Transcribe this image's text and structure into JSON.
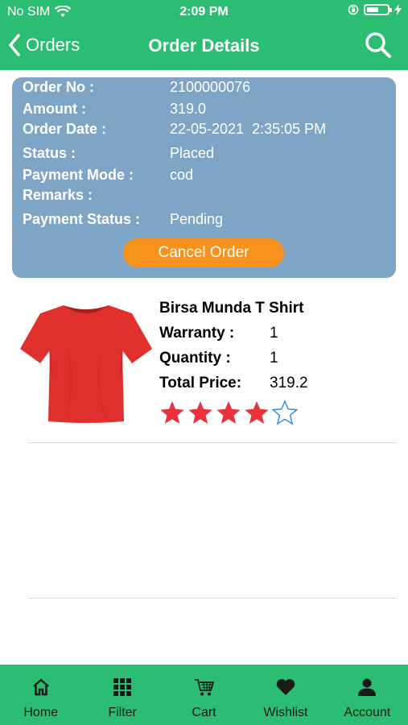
{
  "status_bar": {
    "carrier": "No SIM",
    "time": "2:09 PM"
  },
  "nav": {
    "back_label": "Orders",
    "title": "Order Details"
  },
  "order": {
    "order_no_label": "Order No :",
    "order_no": "2100000076",
    "amount_label": "Amount :",
    "amount": "319.0",
    "date_label": "Order Date :",
    "date": "22-05-2021  2:35:05 PM",
    "status_label": "Status :",
    "status": "Placed",
    "payment_mode_label": "Payment Mode :",
    "payment_mode": "cod",
    "remarks_label": "Remarks :",
    "remarks": "",
    "payment_status_label": "Payment Status :",
    "payment_status": "Pending",
    "cancel_label": "Cancel Order"
  },
  "product": {
    "name": "Birsa Munda T Shirt",
    "warranty_label": "Warranty :",
    "warranty": "1",
    "quantity_label": "Quantity :",
    "quantity": "1",
    "total_label": "Total Price:",
    "total": "319.2",
    "rating": 4,
    "rating_max": 5
  },
  "tabs": [
    {
      "label": "Home",
      "icon": "home-icon"
    },
    {
      "label": "Filter",
      "icon": "grid-icon"
    },
    {
      "label": "Cart",
      "icon": "cart-icon"
    },
    {
      "label": "Wishlist",
      "icon": "heart-icon"
    },
    {
      "label": "Account",
      "icon": "user-icon"
    }
  ],
  "colors": {
    "header": "#2bbd71",
    "card": "#7ea5c5",
    "button": "#f7921e",
    "star": "#e8323c",
    "star_empty": "#3d8fd6"
  }
}
